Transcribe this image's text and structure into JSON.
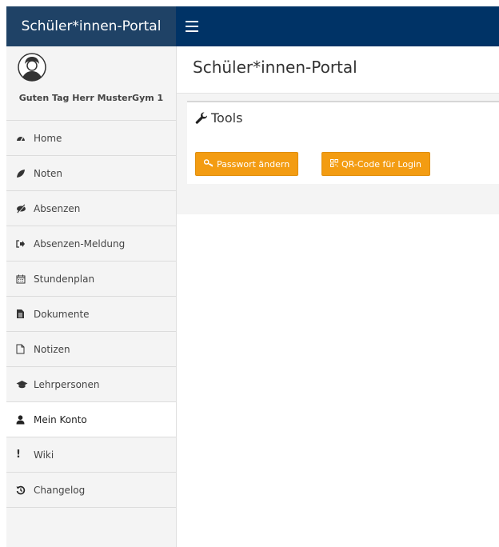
{
  "app": {
    "brand": "Schüler*innen-Portal"
  },
  "user": {
    "greeting": "Guten Tag Herr MusterGym 1"
  },
  "sidebar": {
    "items": [
      {
        "label": "Home",
        "icon": "dashboard-icon"
      },
      {
        "label": "Noten",
        "icon": "leaf-icon"
      },
      {
        "label": "Absenzen",
        "icon": "eye-slash-icon"
      },
      {
        "label": "Absenzen-Meldung",
        "icon": "sign-out-icon"
      },
      {
        "label": "Stundenplan",
        "icon": "calendar-icon"
      },
      {
        "label": "Dokumente",
        "icon": "file-text-icon"
      },
      {
        "label": "Notizen",
        "icon": "file-outline-icon"
      },
      {
        "label": "Lehrpersonen",
        "icon": "graduation-cap-icon"
      },
      {
        "label": "Mein Konto",
        "icon": "user-icon",
        "active": true
      },
      {
        "label": "Wiki",
        "icon": "exclamation-icon"
      },
      {
        "label": "Changelog",
        "icon": "history-icon"
      }
    ]
  },
  "main": {
    "page_title": "Schüler*innen-Portal",
    "panel": {
      "title": "Tools",
      "buttons": {
        "password": "Passwort ändern",
        "qrcode": "QR-Code für Login"
      }
    }
  },
  "colors": {
    "topbar": "#003366",
    "brand_bg": "#1f4266",
    "button": "#f39c12",
    "sidebar_bg": "#f4f4f4"
  }
}
